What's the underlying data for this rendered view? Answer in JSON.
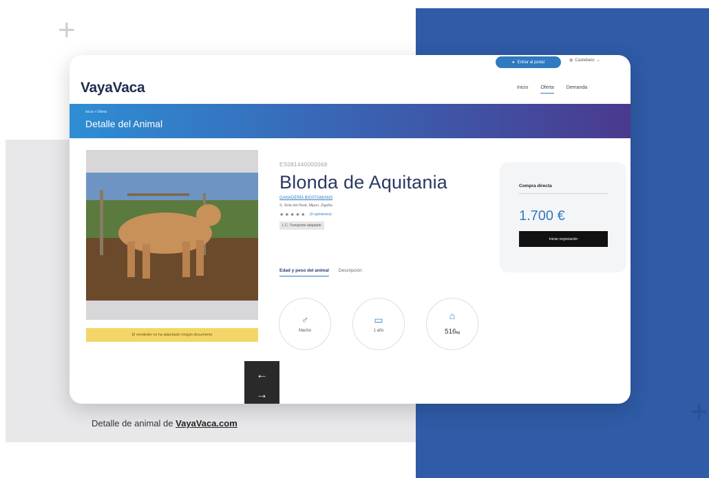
{
  "header": {
    "logo": "VayaVaca",
    "portal_button": "Entrar al portal",
    "language": "Castellano",
    "nav": [
      "Inicio",
      "Oferta",
      "Demanda"
    ]
  },
  "banner": {
    "breadcrumb": "Inicio > Oferta",
    "title": "Detalle del Animal"
  },
  "animal": {
    "ear_id": "ES081440000068",
    "name": "Blonda de Aquitania",
    "breed_link": "GANADERÍA BIGSTAM/ANS",
    "location": "S. Sola del Real, Mijaví, Zigaña",
    "stars": "★★★★★",
    "reviews": "(0 opiniones)",
    "transport": "L.C. Transporte adaptado",
    "doc_warning": "El vendedor no ha adjuntado ningún documento"
  },
  "tabs": [
    "Edad y peso del animal",
    "Descripción"
  ],
  "stats": {
    "sex_icon": "male-icon",
    "sex_label": "Macho",
    "age_icon": "calendar-icon",
    "age_label": "1 año",
    "weight_icon": "weight-icon",
    "weight_value": "516",
    "weight_unit": "kg"
  },
  "purchase": {
    "title": "Compra directa",
    "price": "1.700 €",
    "button": "Iniciar negociación"
  },
  "caption": {
    "prefix": "Detalle de animal de ",
    "site": "VayaVaca.com"
  },
  "colors": {
    "brand_blue": "#2f5ba7",
    "accent": "#2f7ac0",
    "warning": "#f4d668"
  }
}
